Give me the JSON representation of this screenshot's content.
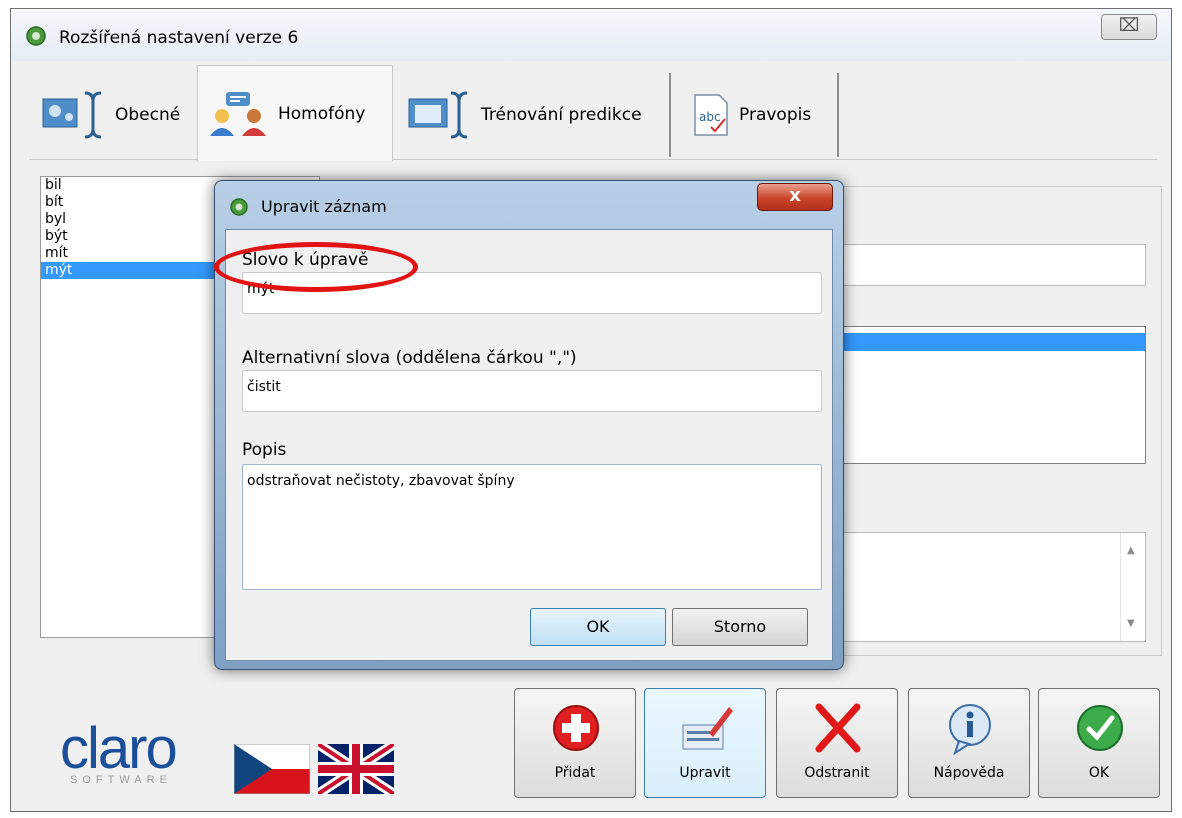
{
  "window": {
    "title": "Rozšířená nastavení verze 6",
    "close_glyph": "⌧"
  },
  "tabs": [
    {
      "label": "Obecné",
      "icon": "settings-tab-icon",
      "active": false
    },
    {
      "label": "Homofóny",
      "icon": "people-tab-icon",
      "active": true
    },
    {
      "label": "Trénování predikce",
      "icon": "book-tab-icon",
      "active": false
    },
    {
      "label": "Pravopis",
      "icon": "spellcheck-tab-icon",
      "active": false
    }
  ],
  "word_list": {
    "items": [
      "bil",
      "bít",
      "byl",
      "být",
      "mít",
      "mýt"
    ],
    "selected": "mýt"
  },
  "dialog": {
    "title": "Upravit záznam",
    "close_glyph": "x",
    "word_label": "Slovo k úpravě",
    "word_value": "mýt",
    "alternatives_label": "Alternativní slova (oddělena čárkou \",\")",
    "alternatives_value": "čistit",
    "description_label": "Popis",
    "description_value": "odstraňovat nečistoty, zbavovat špíny",
    "ok_label": "OK",
    "cancel_label": "Storno"
  },
  "logo": {
    "name": "claro",
    "sub": "SOFTWARE"
  },
  "languages": [
    "cz-flag",
    "uk-flag"
  ],
  "buttons": {
    "add": "Přidat",
    "edit": "Upravit",
    "remove": "Odstranit",
    "help": "Nápověda",
    "ok": "OK"
  },
  "colors": {
    "selection": "#3399ff",
    "annotation": "#e21313",
    "brand": "#1c4f9a"
  }
}
